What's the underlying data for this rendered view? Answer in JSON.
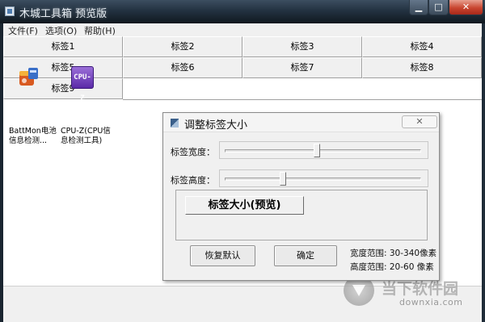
{
  "window": {
    "title": "木城工具箱 预览版",
    "minimize_glyph": "▁",
    "maximize_glyph": "□",
    "close_glyph": "✕"
  },
  "menu": {
    "file": "文件(F)",
    "options": "选项(O)",
    "help": "帮助(H)"
  },
  "tabs": [
    "标签1",
    "标签2",
    "标签3",
    "标签4",
    "标签5",
    "标签6",
    "标签7",
    "标签8",
    "标签9"
  ],
  "desktop_icons": [
    {
      "name": "battmon",
      "icon": "battmon-icon",
      "line1": "BattMon电池",
      "line2": "信息检测..."
    },
    {
      "name": "cpuz",
      "icon": "cpuz-icon",
      "icon_text": "CPU-Z",
      "line1": "CPU-Z(CPU信",
      "line2": "息检测工具)"
    }
  ],
  "dialog": {
    "title": "调整标签大小",
    "close_glyph": "✕",
    "width_label": "标签宽度：",
    "height_label": "标签高度：",
    "width_slider_position": 0.47,
    "height_slider_position": 0.29,
    "preview_tag": "标签大小(预览)",
    "restore_button": "恢复默认",
    "ok_button": "确定",
    "width_range": "宽度范围: 30-340像素",
    "height_range": "高度范围: 20-60 像素"
  },
  "watermark": {
    "cn": "当下软件园",
    "url": "downxia.com"
  },
  "colors": {
    "titlebar": "#233241",
    "close_button": "#c8452f",
    "dialog_bg": "#f0f0f0",
    "tab_bg": "#f0f0f0"
  }
}
